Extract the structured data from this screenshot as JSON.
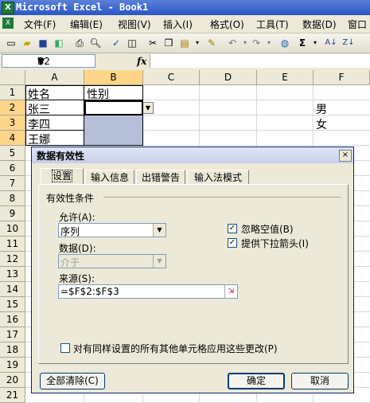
{
  "window": {
    "title": "Microsoft Excel - Book1",
    "app_icon": "excel-icon"
  },
  "menu": [
    "文件(F)",
    "编辑(E)",
    "视图(V)",
    "插入(I)",
    "格式(O)",
    "工具(T)",
    "数据(D)",
    "窗口"
  ],
  "formula_bar": {
    "name_box": "B2",
    "fx": "fx",
    "formula": ""
  },
  "grid": {
    "columns": [
      "A",
      "B",
      "C",
      "D",
      "E",
      "F"
    ],
    "rows": [
      "1",
      "2",
      "3",
      "4",
      "5",
      "6",
      "7",
      "8",
      "9",
      "10",
      "11",
      "12",
      "13",
      "14",
      "15",
      "16",
      "17",
      "18",
      "19",
      "20",
      "21"
    ],
    "cells": {
      "A1": "姓名",
      "B1": "性别",
      "A2": "张三",
      "A3": "李四",
      "A4": "王娜",
      "F2": "男",
      "F3": "女"
    }
  },
  "dialog": {
    "title": "数据有效性",
    "close": "×",
    "tabs": [
      "设置",
      "输入信息",
      "出错警告",
      "输入法模式"
    ],
    "group_label": "有效性条件",
    "allow_label": "允许(A):",
    "allow_value": "序列",
    "data_label": "数据(D):",
    "data_value": "介于",
    "ignore_blank_label": "忽略空值(B)",
    "ignore_blank_checked": true,
    "dropdown_label": "提供下拉箭头(I)",
    "dropdown_checked": true,
    "source_label": "来源(S):",
    "source_value": "=$F$2:$F$3",
    "apply_all_label": "对有同样设置的所有其他单元格应用这些更改(P)",
    "apply_all_checked": false,
    "clear_all_button": "全部清除(C)",
    "ok_button": "确定",
    "cancel_button": "取消"
  }
}
